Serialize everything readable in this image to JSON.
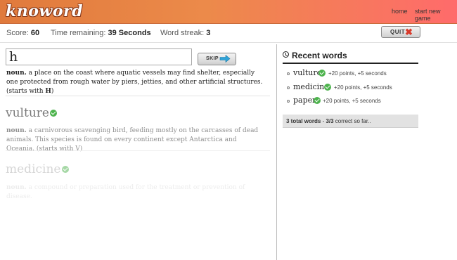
{
  "header": {
    "logo_text": "knoword",
    "nav_home": "home",
    "nav_new_game": "start new game"
  },
  "stats": {
    "score_label": "Score:",
    "score_value": "60",
    "time_label": "Time remaining:",
    "time_value": "39 Seconds",
    "streak_label": "Word streak:",
    "streak_value": "3",
    "quit_label": "QUIT",
    "quit_icon": "close-x-icon"
  },
  "current": {
    "input_value": "h",
    "skip_label": "SKIP",
    "skip_icon": "arrow-right-icon",
    "pos": "noun.",
    "definition": "a place on the coast where aquatic vessels may find shelter, especially one protected from rough water by piers, jetties, and other artificial structures.",
    "hint_prefix": "(starts with",
    "hint_letter": "H",
    "hint_suffix": ")"
  },
  "history": [
    {
      "word": "vulture",
      "pos": "noun.",
      "definition": "a carnivorous scavenging bird, feeding mostly on the carcasses of dead animals. This species is found on every continent except Antarctica and Oceania.",
      "hint": "(starts with V)"
    },
    {
      "word": "medicine",
      "pos": "noun.",
      "definition": "a compound or preparation used for the treatment or prevention of disease."
    }
  ],
  "recent": {
    "title": "Recent words",
    "items": [
      {
        "word": "vulture",
        "points": "+20 points, +5 seconds"
      },
      {
        "word": "medicine",
        "points": "+20 points, +5 seconds"
      },
      {
        "word": "paper",
        "points": "+20 points, +5 seconds"
      }
    ],
    "summary_bold": "3 total words",
    "summary_sep": " - ",
    "summary_count": "3/3",
    "summary_rest": " correct so far.."
  },
  "colors": {
    "accent_green": "#4db34d",
    "header_orange": "#e07a3c",
    "header_red": "#ff6b6b",
    "quit_red": "#d83a2b",
    "skip_arrow_blue": "#2fa3d8"
  }
}
